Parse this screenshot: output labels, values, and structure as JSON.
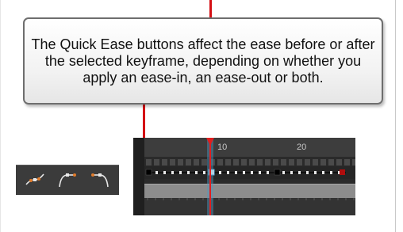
{
  "callout": {
    "text": "The Quick Ease buttons affect the ease before or after the selected keyframe, depending on whether you apply an ease-in, an ease-out or both."
  },
  "quick_ease": {
    "buttons": [
      {
        "name": "ease-in-out",
        "icon": "ease-in-out-icon"
      },
      {
        "name": "ease-out",
        "icon": "ease-out-icon"
      },
      {
        "name": "ease-in",
        "icon": "ease-in-icon"
      }
    ]
  },
  "timeline": {
    "frame_labels": [
      "10",
      "20"
    ],
    "current_frame": 9,
    "colors": {
      "accent_red": "#d40f14",
      "keyframe_black": "#000000",
      "keyframe_last": "#b00d0d",
      "curve_orange": "#e07b2a",
      "icon_white": "#e8e8e8",
      "selection_blue": "#5fa8d3"
    }
  }
}
